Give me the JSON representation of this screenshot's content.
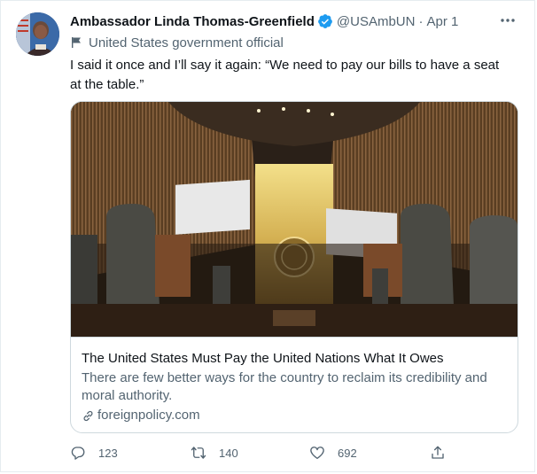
{
  "tweet": {
    "author_name": "Ambassador Linda Thomas-Greenfield",
    "handle": "@USAmbUN",
    "separator": "·",
    "date": "Apr 1",
    "label": "United States government official",
    "text": "I said it once and I’ll say it again: “We need to pay our bills to have a seat at the table.”"
  },
  "card": {
    "title": "The United States Must Pay the United Nations What It Owes",
    "description": "There are few better ways for the country to reclaim its credibility and moral authority.",
    "domain": "foreignpolicy.com",
    "image_alt": "UN General Assembly Hall"
  },
  "actions": {
    "replies": "123",
    "retweets": "140",
    "likes": "692"
  },
  "colors": {
    "verified": "#1d9bf0",
    "secondary_text": "#536471",
    "primary_text": "#0f1419",
    "border": "#cfd9de"
  },
  "icons": {
    "verified": "verified-badge-icon",
    "more": "more-icon",
    "flag": "flag-icon",
    "link": "link-icon",
    "reply": "reply-icon",
    "retweet": "retweet-icon",
    "like": "heart-icon",
    "share": "share-icon"
  }
}
